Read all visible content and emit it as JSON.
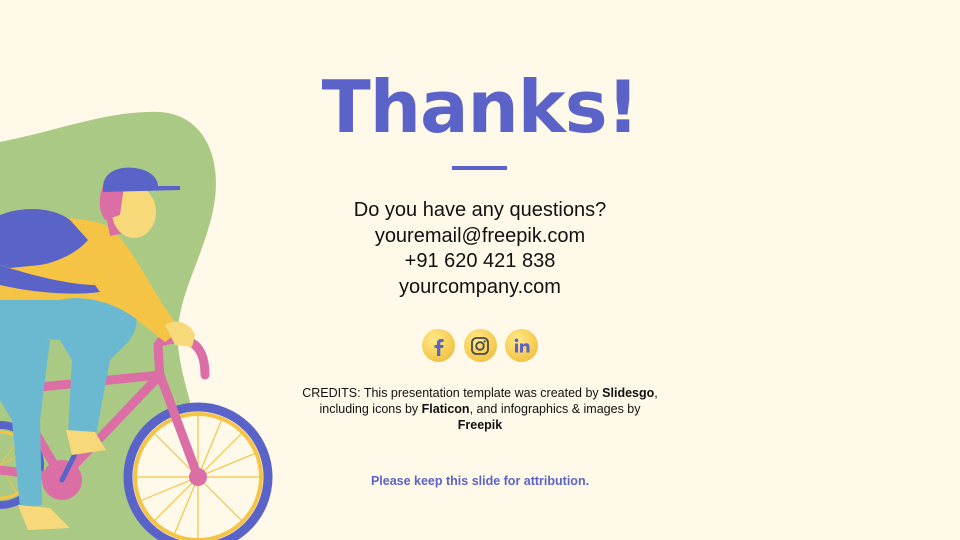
{
  "slide": {
    "title": "Thanks!",
    "contact": {
      "question": "Do you have any questions?",
      "email": "youremail@freepik.com",
      "phone": "+91 620 421 838",
      "website": "yourcompany.com"
    },
    "socials": [
      {
        "label": "Facebook",
        "icon": "facebook-icon"
      },
      {
        "label": "Instagram",
        "icon": "instagram-icon"
      },
      {
        "label": "LinkedIn",
        "icon": "linkedin-icon"
      }
    ],
    "credits": {
      "text_1": "CREDITS: This presentation template was created by ",
      "slidesgo": "Slidesgo",
      "text_2": ", including icons by ",
      "flaticon": "Flaticon",
      "text_3": ", and infographics & images by ",
      "freepik": "Freepik"
    },
    "attribution": "Please keep this slide for attribution."
  },
  "colors": {
    "background": "#fef9e8",
    "accent": "#5b63c9",
    "blob_green": "#a9c985",
    "bike_pink": "#db6fa5",
    "wheel_blue": "#5a63c8",
    "shirt_yellow": "#f6c445",
    "pants_blue": "#6bb8d1",
    "skin": "#f8d97a"
  }
}
